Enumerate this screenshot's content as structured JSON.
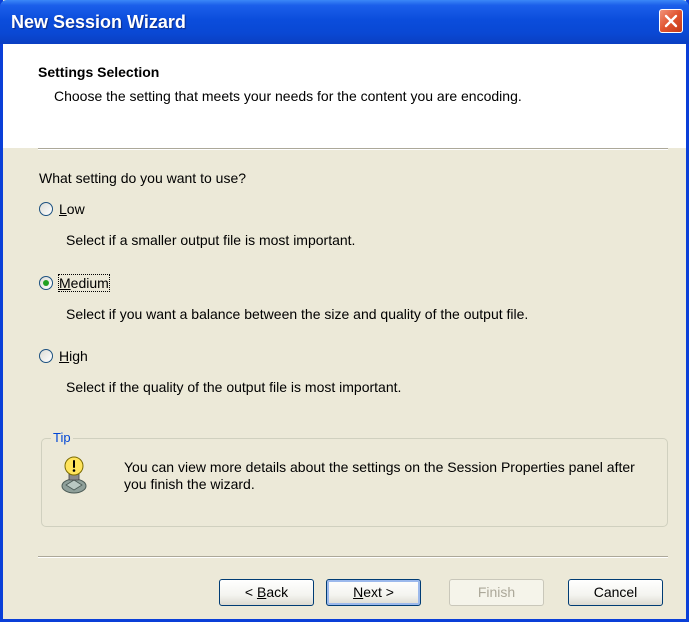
{
  "window": {
    "title": "New Session Wizard"
  },
  "header": {
    "title": "Settings Selection",
    "subtitle": "Choose the setting that meets your needs for the content you are encoding."
  },
  "question": "What setting do you want to use?",
  "options": [
    {
      "label": "Low",
      "checked": false,
      "description": "Select if a smaller output file is most important."
    },
    {
      "label": "Medium",
      "checked": true,
      "description": "Select if you want a balance between the size and quality of the output file."
    },
    {
      "label": "High",
      "checked": false,
      "description": "Select if the quality of the output file is most important."
    }
  ],
  "tip": {
    "legend": "Tip",
    "text": "You can view more details about the settings on the Session Properties panel after you finish the wizard.",
    "icon": "lightbulb-icon"
  },
  "buttons": {
    "back": {
      "prefix": "< ",
      "mnemonic": "B",
      "rest": "ack"
    },
    "next": {
      "mnemonic": "N",
      "rest": "ext >"
    },
    "finish": "Finish",
    "cancel": "Cancel"
  },
  "colors": {
    "titlebar": "#0a48d4",
    "dialog": "#ece9d8",
    "accent": "#0046d5",
    "radio_dot": "#21a121",
    "close": "#e0532f"
  }
}
